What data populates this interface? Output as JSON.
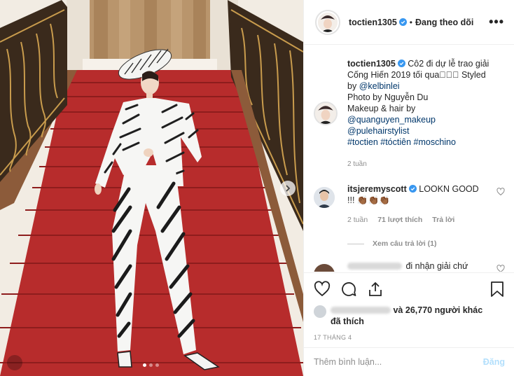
{
  "header": {
    "username": "toctien1305",
    "separator": "•",
    "follow_status": "Đang theo dõi",
    "more_icon": "more-horizontal-icon",
    "more_label": "•••"
  },
  "caption": {
    "username": "toctien1305",
    "lines": [
      "Cô2 đi dự lễ trao giải",
      "Cống Hiến 2019 tối qua🏻🏻🏻 Styled",
      "by",
      "Photo by Nguyễn Du",
      "Makeup & hair by",
      "@quanguyen_makeup",
      "@pulehairstylist"
    ],
    "mention_stylist": "@kelbinlei",
    "hashtags": "#toctien #tóctiên #moschino",
    "time": "2 tuần"
  },
  "comments": [
    {
      "username": "itsjeremyscott",
      "text": "LOOKN GOOD",
      "text2": "!!! 👏🏾👏🏾👏🏾",
      "time": "2 tuần",
      "likes": "71 lượt thích",
      "reply": "Trả lời"
    }
  ],
  "view_replies": "Xem câu trả lời (1)",
  "blurred_comment": {
    "text": "đi nhận giải chứ",
    "emoji": "😀"
  },
  "likes": {
    "text": "và 26,770 người khác",
    "text2": "đã thích"
  },
  "date": "17 THÁNG 4",
  "add_comment": {
    "placeholder": "Thêm bình luận...",
    "post_label": "Đăng"
  },
  "carousel": {
    "slides": 3,
    "active": 1
  },
  "colors": {
    "verified": "#3897f0",
    "link": "#00376b",
    "secondary": "#8e8e8e",
    "carpet": "#b22a2a",
    "post_disabled": "#b2dffc"
  }
}
